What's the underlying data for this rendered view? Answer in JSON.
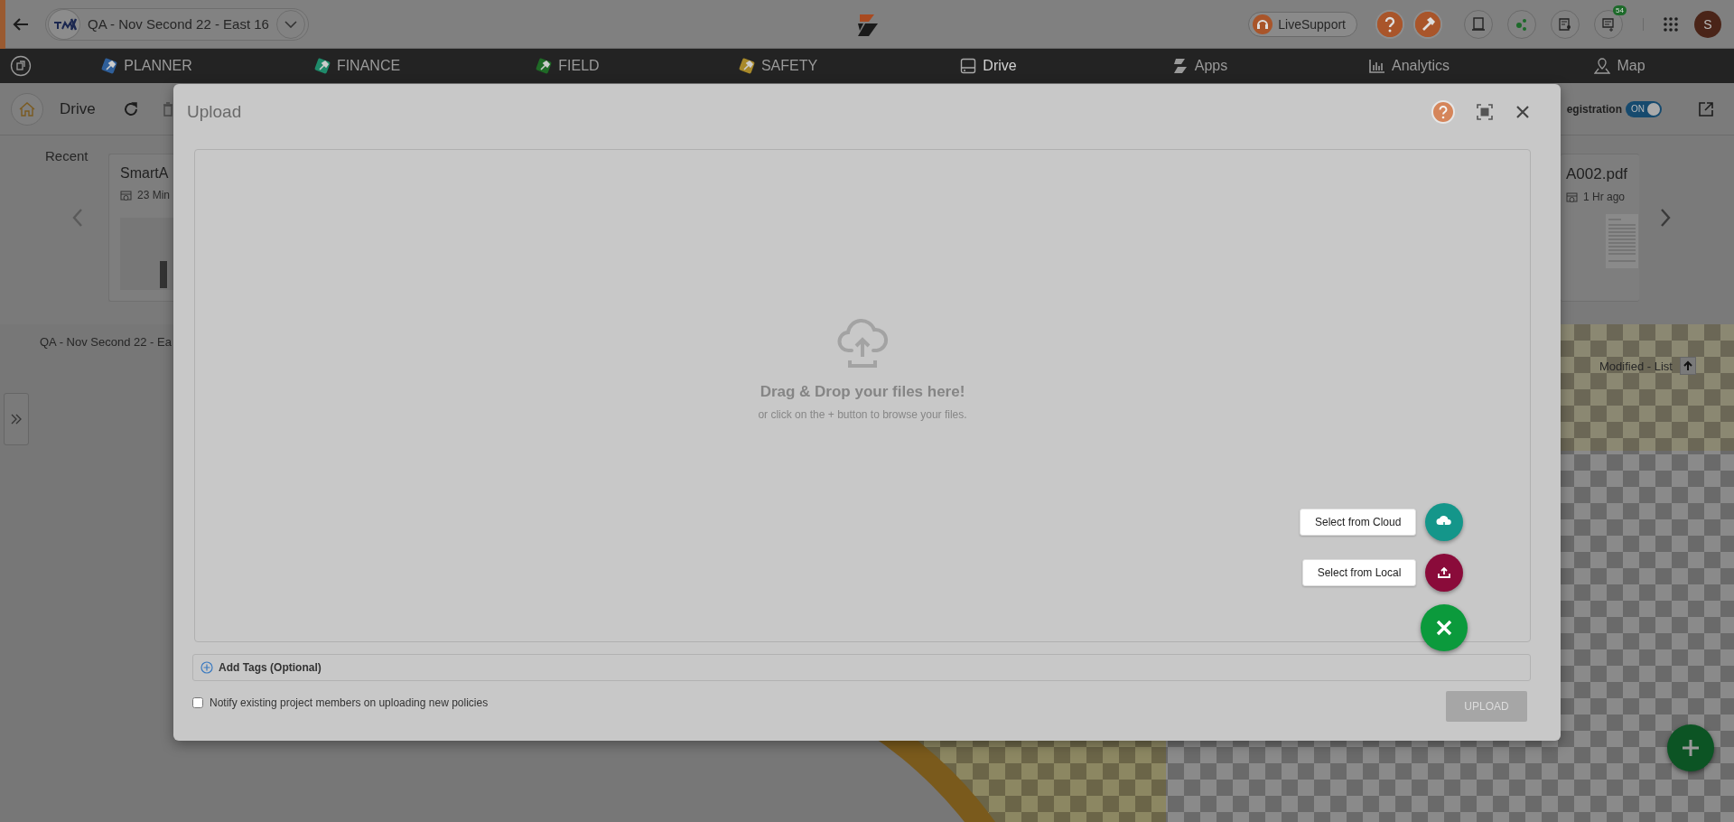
{
  "header": {
    "project": "QA - Nov Second 22 - East 16",
    "live_support": "LiveSupport",
    "cart_badge": "54",
    "avatar": "S"
  },
  "nav": {
    "items": [
      {
        "label": "PLANNER",
        "kind": "tile",
        "color": "#2f5f9a",
        "selected": false
      },
      {
        "label": "FINANCE",
        "kind": "tile",
        "color": "#1f8a6a",
        "selected": false
      },
      {
        "label": "FIELD",
        "kind": "tile",
        "color": "#1f6a26",
        "selected": false
      },
      {
        "label": "SAFETY",
        "kind": "tile",
        "color": "#a8892a",
        "selected": false
      },
      {
        "label": "Drive",
        "kind": "drive",
        "selected": true
      },
      {
        "label": "Apps",
        "kind": "apps",
        "selected": false
      },
      {
        "label": "Analytics",
        "kind": "analytics",
        "selected": false
      },
      {
        "label": "Map",
        "kind": "map",
        "selected": false
      }
    ]
  },
  "toolbar": {
    "title": "Drive",
    "registration_label": "egistration",
    "registration_toggle": {
      "label": "ON",
      "on": true
    }
  },
  "recent": {
    "label": "Recent",
    "files": [
      {
        "name": "SmartA",
        "time": "23 Min"
      },
      {
        "name": "A002.pdf",
        "time": "1 Hr ago"
      }
    ]
  },
  "breadcrumb": "QA - Nov Second 22 - Ea",
  "sort": {
    "label": "Modified - List"
  },
  "dialog": {
    "title": "Upload",
    "drop_title": "Drag & Drop your files here!",
    "drop_hint": "or click on the + button to browse your files.",
    "actions": [
      {
        "label": "Select from Cloud",
        "kind": "cloud",
        "color": "#14968a"
      },
      {
        "label": "Select from Local",
        "kind": "local",
        "color": "#8a0b3a"
      }
    ],
    "add_tags": "Add Tags (Optional)",
    "notify": {
      "label": "Notify existing project members on uploading new policies",
      "checked": false
    },
    "upload_button": {
      "label": "UPLOAD",
      "disabled": true
    }
  }
}
